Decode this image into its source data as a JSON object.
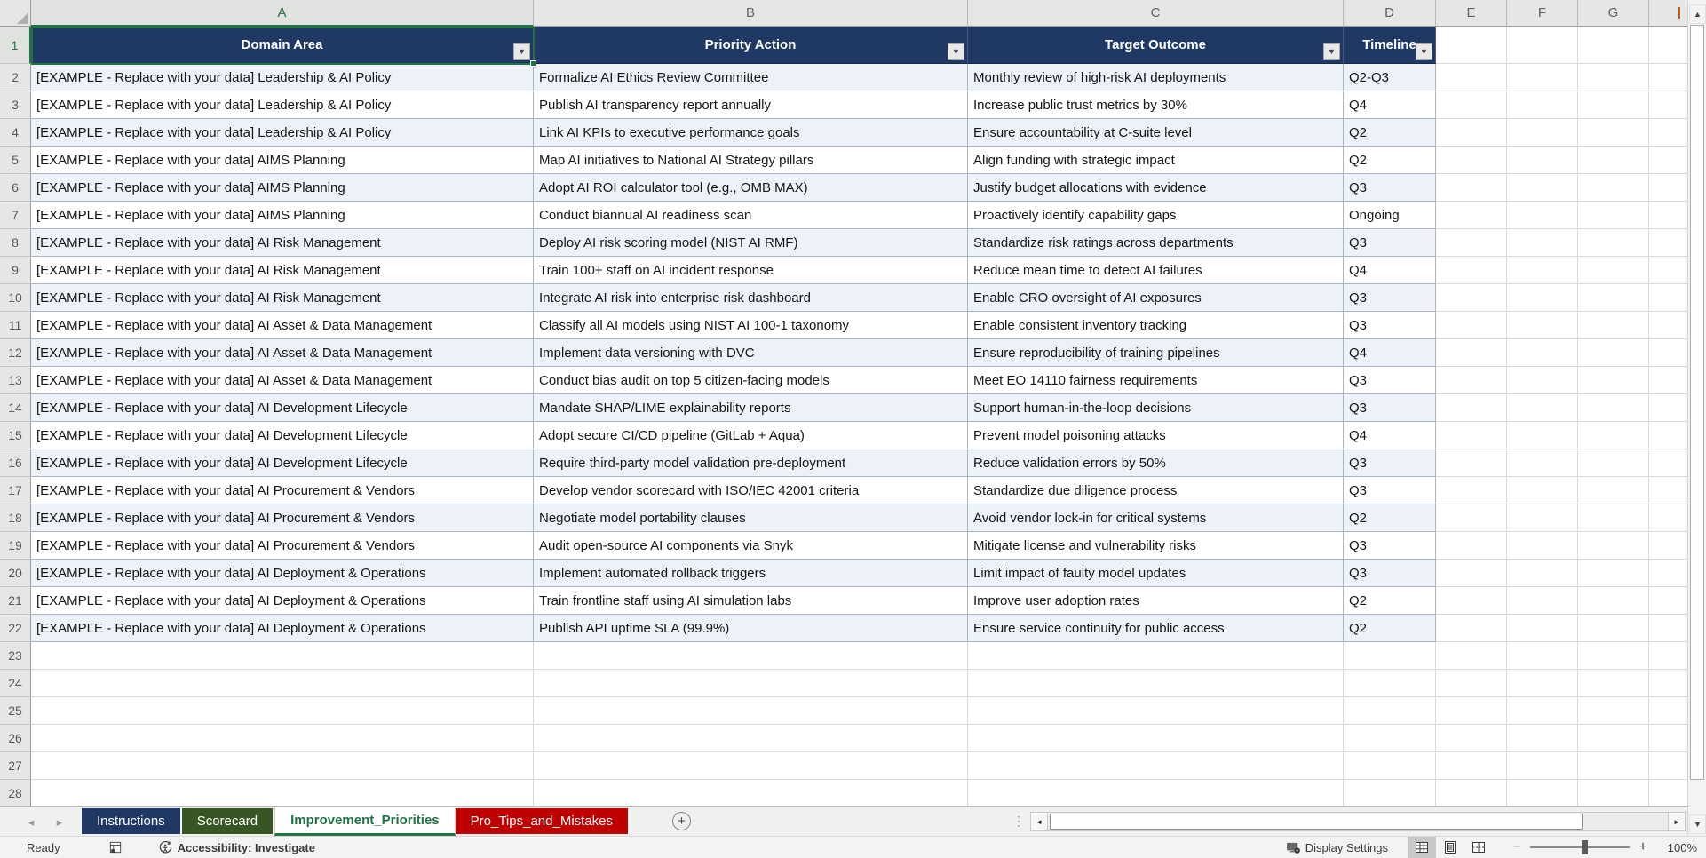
{
  "grid": {
    "column_letters": [
      "A",
      "B",
      "C",
      "D",
      "E",
      "F",
      "G"
    ],
    "selected_cell": "A1",
    "selected_column": "A",
    "selected_row": 1,
    "visible_rows": 28,
    "table": {
      "headers": [
        "Domain Area",
        "Priority Action",
        "Target Outcome",
        "Timeline"
      ],
      "rows": [
        [
          "[EXAMPLE - Replace with your data] Leadership & AI Policy",
          "Formalize AI Ethics Review Committee",
          "Monthly review of high-risk AI deployments",
          "Q2-Q3"
        ],
        [
          "[EXAMPLE - Replace with your data] Leadership & AI Policy",
          "Publish AI transparency report annually",
          "Increase public trust metrics by 30%",
          "Q4"
        ],
        [
          "[EXAMPLE - Replace with your data] Leadership & AI Policy",
          "Link AI KPIs to executive performance goals",
          "Ensure accountability at C-suite level",
          "Q2"
        ],
        [
          "[EXAMPLE - Replace with your data] AIMS Planning",
          "Map AI initiatives to National AI Strategy pillars",
          "Align funding with strategic impact",
          "Q2"
        ],
        [
          "[EXAMPLE - Replace with your data] AIMS Planning",
          "Adopt AI ROI calculator tool (e.g., OMB MAX)",
          "Justify budget allocations with evidence",
          "Q3"
        ],
        [
          "[EXAMPLE - Replace with your data] AIMS Planning",
          "Conduct biannual AI readiness scan",
          "Proactively identify capability gaps",
          "Ongoing"
        ],
        [
          "[EXAMPLE - Replace with your data] AI Risk Management",
          "Deploy AI risk scoring model (NIST AI RMF)",
          "Standardize risk ratings across departments",
          "Q3"
        ],
        [
          "[EXAMPLE - Replace with your data] AI Risk Management",
          "Train 100+ staff on AI incident response",
          "Reduce mean time to detect AI failures",
          "Q4"
        ],
        [
          "[EXAMPLE - Replace with your data] AI Risk Management",
          "Integrate AI risk into enterprise risk dashboard",
          "Enable CRO oversight of AI exposures",
          "Q3"
        ],
        [
          "[EXAMPLE - Replace with your data] AI Asset & Data Management",
          "Classify all AI models using NIST AI 100-1 taxonomy",
          "Enable consistent inventory tracking",
          "Q3"
        ],
        [
          "[EXAMPLE - Replace with your data] AI Asset & Data Management",
          "Implement data versioning with DVC",
          "Ensure reproducibility of training pipelines",
          "Q4"
        ],
        [
          "[EXAMPLE - Replace with your data] AI Asset & Data Management",
          "Conduct bias audit on top 5 citizen-facing models",
          "Meet EO 14110 fairness requirements",
          "Q3"
        ],
        [
          "[EXAMPLE - Replace with your data] AI Development Lifecycle",
          "Mandate SHAP/LIME explainability reports",
          "Support human-in-the-loop decisions",
          "Q3"
        ],
        [
          "[EXAMPLE - Replace with your data] AI Development Lifecycle",
          "Adopt secure CI/CD pipeline (GitLab + Aqua)",
          "Prevent model poisoning attacks",
          "Q4"
        ],
        [
          "[EXAMPLE - Replace with your data] AI Development Lifecycle",
          "Require third-party model validation pre-deployment",
          "Reduce validation errors by 50%",
          "Q3"
        ],
        [
          "[EXAMPLE - Replace with your data] AI Procurement & Vendors",
          "Develop vendor scorecard with ISO/IEC 42001 criteria",
          "Standardize due diligence process",
          "Q3"
        ],
        [
          "[EXAMPLE - Replace with your data] AI Procurement & Vendors",
          "Negotiate model portability clauses",
          "Avoid vendor lock-in for critical systems",
          "Q2"
        ],
        [
          "[EXAMPLE - Replace with your data] AI Procurement & Vendors",
          "Audit open-source AI components via Snyk",
          "Mitigate license and vulnerability risks",
          "Q3"
        ],
        [
          "[EXAMPLE - Replace with your data] AI Deployment & Operations",
          "Implement automated rollback triggers",
          "Limit impact of faulty model updates",
          "Q3"
        ],
        [
          "[EXAMPLE - Replace with your data] AI Deployment & Operations",
          "Train frontline staff using AI simulation labs",
          "Improve user adoption rates",
          "Q2"
        ],
        [
          "[EXAMPLE - Replace with your data] AI Deployment & Operations",
          "Publish API uptime SLA (99.9%)",
          "Ensure service continuity for public access",
          "Q2"
        ]
      ]
    }
  },
  "sheet_tabs": {
    "tabs": [
      {
        "label": "Instructions",
        "bg": "#1F3864",
        "fg": "#FFFFFF",
        "active": false
      },
      {
        "label": "Scorecard",
        "bg": "#375623",
        "fg": "#FFFFFF",
        "active": false
      },
      {
        "label": "Improvement_Priorities",
        "bg": "#FFFFFF",
        "fg": "#217346",
        "active": true
      },
      {
        "label": "Pro_Tips_and_Mistakes",
        "bg": "#C00000",
        "fg": "#FFFFFF",
        "active": false
      }
    ],
    "add_sheet_glyph": "+"
  },
  "icons": {
    "filter_arrow": "▼",
    "scroll_up": "▲",
    "scroll_down": "▼",
    "scroll_left": "◄",
    "scroll_right": "►",
    "tab_nav_left": "◂",
    "tab_nav_right": "▸",
    "grip": "⋮"
  },
  "status_bar": {
    "ready_label": "Ready",
    "accessibility_label": "Accessibility: Investigate",
    "display_settings_label": "Display Settings",
    "zoom_minus": "−",
    "zoom_plus": "+",
    "zoom_percent": "100%"
  },
  "colors": {
    "table_header_fill": "#1F3864",
    "banded_row_fill": "#EDF2F9",
    "selection_green": "#217346",
    "tab_navy": "#1F3864",
    "tab_green": "#375623",
    "tab_red": "#C00000",
    "header_gray": "#E6E6E6"
  }
}
